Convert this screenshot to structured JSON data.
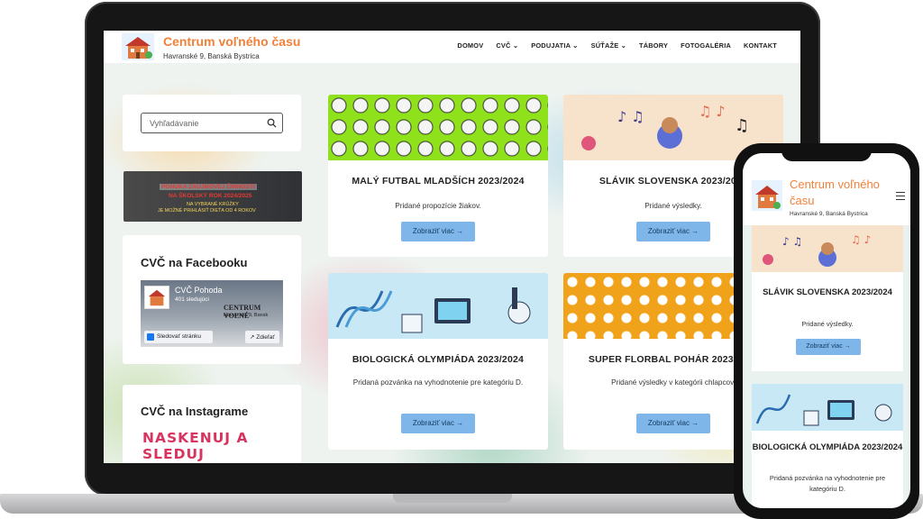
{
  "site": {
    "title": "Centrum voľného času",
    "address": "Havranské 9, Banská Bystrica",
    "mobile_title": "Centrum voľného času"
  },
  "nav": {
    "items": [
      "DOMOV",
      "CVČ",
      "PODUJATIA",
      "SÚŤAŽE",
      "TÁBORY",
      "FOTOGALÉRIA",
      "KONTAKT"
    ],
    "dropdown_markers": [
      "",
      "⌄",
      "⌄",
      "⌄",
      "",
      "",
      ""
    ]
  },
  "sidebar": {
    "search_placeholder": "Vyhľadávanie",
    "banner": {
      "line1": "PONUKA ZÁUJMOVEJ ČINNOSTI",
      "line2": "NA ŠKOLSKÝ ROK 2024/2025",
      "line3": "NA VYBRANÉ KRÚŽKY",
      "line4": "JE MOŽNÉ PRIHLÁSIŤ DIEŤA OD 4 ROKOV"
    },
    "facebook": {
      "title": "CVČ na Facebooku",
      "page_name": "CVČ Pohoda",
      "followers": "401 sledujúci",
      "cover_title": "CENTRUM VOĽNÉ",
      "cover_sub": "Havranské 9, Bansk",
      "follow_label": "Sledovať stránku",
      "share_label": "Zdieľať"
    },
    "instagram": {
      "title": "CVČ na Instagrame",
      "banner": "NASKENUJ A SLEDUJ"
    }
  },
  "posts": [
    {
      "title": "MALÝ FUTBAL MLADŠÍCH 2023/2024",
      "excerpt": "Pridané propozície žiakov.",
      "button": "Zobraziť viac  →"
    },
    {
      "title": "SLÁVIK SLOVENSKA 2023/2024",
      "excerpt": "Pridané výsledky.",
      "button": "Zobraziť viac  →"
    },
    {
      "title": "BIOLOGICKÁ OLYMPIÁDA 2023/2024",
      "excerpt": "Pridaná pozvánka na vyhodnotenie pre kategóriu D.",
      "button": "Zobraziť viac  →"
    },
    {
      "title": "SUPER FLORBAL POHÁR 2023/2024",
      "excerpt": "Pridané výsledky v kategórii chlapcov.",
      "button": "Zobraziť viac  →"
    }
  ],
  "mobile_posts": [
    {
      "title": "SLÁVIK SLOVENSKA 2023/2024",
      "excerpt": "Pridané výsledky.",
      "button": "Zobraziť viac  →"
    },
    {
      "title": "BIOLOGICKÁ OLYMPIÁDA 2023/2024",
      "excerpt": "Pridaná pozvánka na vyhodnotenie pre kategóriu D.",
      "button": "Zobraziť viac  →"
    }
  ],
  "colors": {
    "brand_orange": "#f0813b",
    "button_blue": "#7fb6ea",
    "instagram_pink": "#d8345f"
  }
}
